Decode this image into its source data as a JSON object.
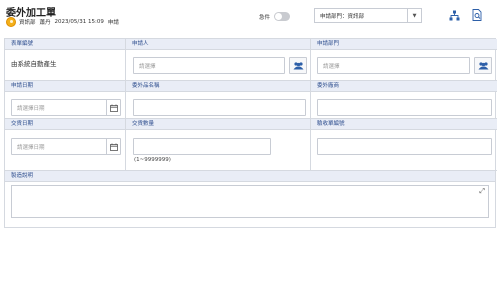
{
  "header": {
    "title": "委外加工單",
    "department": "資訊部",
    "user": "蕭丹",
    "datetime": "2023/05/31 15:09",
    "status": "申請",
    "urgent_label": "急件",
    "urgent_on": false,
    "dept_select_value": "申請部門：資訊部"
  },
  "icons": {
    "org": "org-chart-icon",
    "doc": "document-search-icon",
    "people": "people-icon",
    "calendar": "calendar-icon",
    "expand": "expand-icon"
  },
  "form": {
    "row1": {
      "form_no_label": "表單編號",
      "form_no_value": "由系統自動產生",
      "applicant_label": "申請人",
      "applicant_placeholder": "請選擇",
      "dept_label": "申請部門",
      "dept_placeholder": "請選擇"
    },
    "row2": {
      "apply_date_label": "申請日期",
      "apply_date_placeholder": "請選擇日期",
      "product_label": "委外品名稱",
      "product_value": "",
      "vendor_label": "委外廠商",
      "vendor_value": ""
    },
    "row3": {
      "delivery_date_label": "交貨日期",
      "delivery_date_placeholder": "請選擇日期",
      "quantity_label": "交貨數量",
      "quantity_value": "",
      "quantity_hint": "(1~9999999)",
      "acceptance_label": "驗收單編號",
      "acceptance_value": ""
    },
    "row4": {
      "desc_label": "製造說明",
      "desc_value": ""
    }
  },
  "colors": {
    "header_bg": "#e9edf6",
    "header_text": "#2f4f8f",
    "border": "#d5d9e0",
    "avatar": "#f3b01a",
    "accent": "#2d5fa8"
  }
}
